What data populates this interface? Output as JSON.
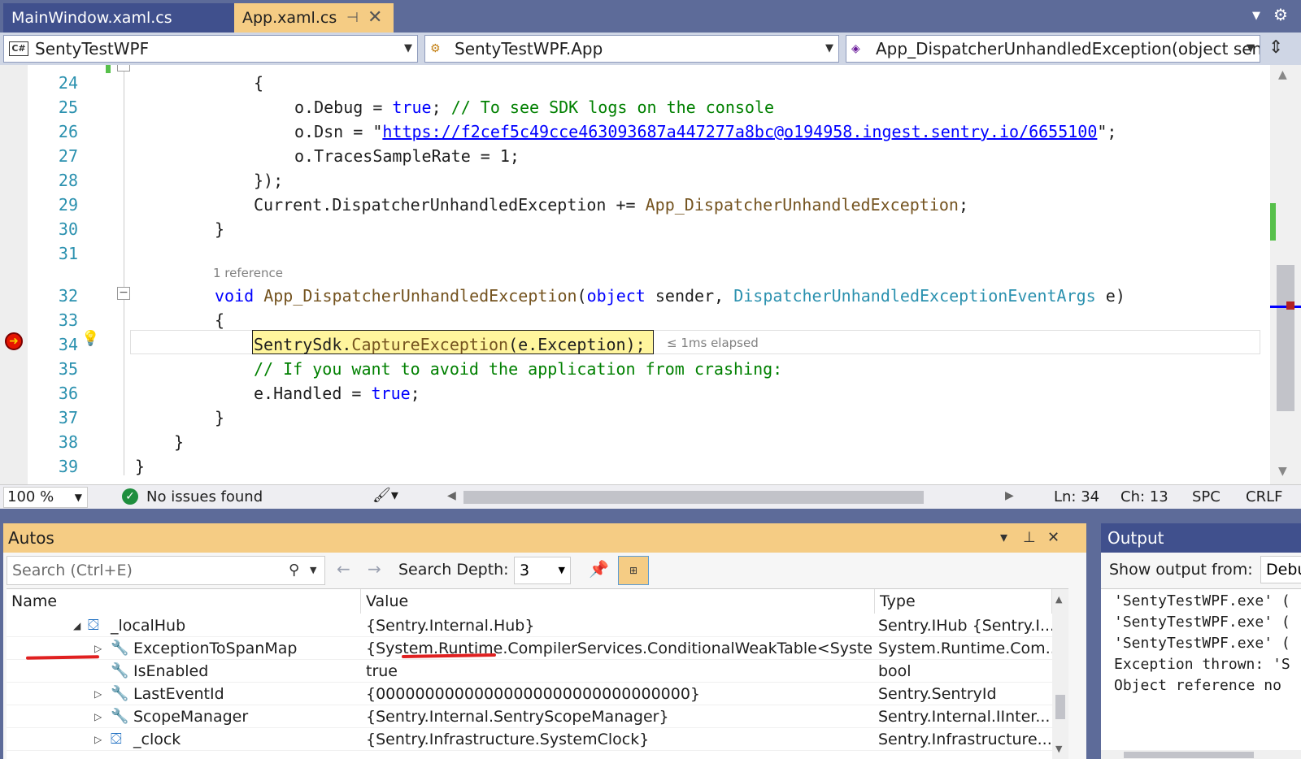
{
  "tabs": {
    "main": "MainWindow.xaml.cs",
    "app": "App.xaml.cs"
  },
  "navbar": {
    "project": "SentyTestWPF",
    "class": "SentyTestWPF.App",
    "member": "App_DispatcherUnhandledException(object send"
  },
  "editor": {
    "line_numbers": [
      "24",
      "25",
      "26",
      "27",
      "28",
      "29",
      "30",
      "31",
      "32",
      "33",
      "34",
      "35",
      "36",
      "37",
      "38",
      "39"
    ],
    "codelens": "1 reference",
    "elapsed": "≤ 1ms elapsed",
    "current_line": 34
  },
  "code": {
    "l24": "{",
    "l25_a": "o.Debug = ",
    "l25_kw": "true",
    "l25_b": "; ",
    "l25_cm": "// To see SDK logs on the console",
    "l26_a": "o.Dsn = \"",
    "l26_url": "https://f2cef5c49cce463093687a447277a8bc@o194958.ingest.sentry.io/6655100",
    "l26_b": "\";",
    "l27": "o.TracesSampleRate = 1;",
    "l28": "});",
    "l29_a": "Current.DispatcherUnhandledException += ",
    "l29_mt": "App_DispatcherUnhandledException",
    "l29_b": ";",
    "l30": "}",
    "l32_kw": "void",
    "l32_mt": "App_DispatcherUnhandledException",
    "l32_a": "(",
    "l32_kw2": "object",
    "l32_b": " sender, ",
    "l32_ty": "DispatcherUnhandledExceptionEventArgs",
    "l32_c": " e)",
    "l33": "{",
    "l34_a": "SentrySdk",
    "l34_b": ".",
    "l34_mt": "CaptureException",
    "l34_c": "(e.Exception);",
    "l35": "// If you want to avoid the application from crashing:",
    "l36_a": "e.Handled = ",
    "l36_kw": "true",
    "l36_b": ";",
    "l37": "}",
    "l38": "}",
    "l39": "}"
  },
  "status": {
    "zoom": "100 %",
    "issues": "No issues found",
    "ln": "Ln: 34",
    "ch": "Ch: 13",
    "spc": "SPC",
    "crlf": "CRLF"
  },
  "autos": {
    "title": "Autos",
    "search_placeholder": "Search (Ctrl+E)",
    "depth_label": "Search Depth:",
    "depth_value": "3",
    "columns": [
      "Name",
      "Value",
      "Type"
    ],
    "rows": [
      {
        "name": "_localHub",
        "value": "{Sentry.Internal.Hub}",
        "type": "Sentry.IHub {Sentry.I..."
      },
      {
        "name": "ExceptionToSpanMap",
        "value": "{System.Runtime.CompilerServices.ConditionalWeakTable<System.E...",
        "type": "System.Runtime.Com..."
      },
      {
        "name": "IsEnabled",
        "value": "true",
        "type": "bool"
      },
      {
        "name": "LastEventId",
        "value": "{00000000000000000000000000000000}",
        "type": "Sentry.SentryId"
      },
      {
        "name": "ScopeManager",
        "value": "{Sentry.Internal.SentryScopeManager}",
        "type": "Sentry.Internal.IInter..."
      },
      {
        "name": "_clock",
        "value": "{Sentry.Infrastructure.SystemClock}",
        "type": "Sentry.Infrastructure...."
      }
    ]
  },
  "output": {
    "title": "Output",
    "show_from": "Show output from:",
    "source": "Debu",
    "lines": [
      "'SentyTestWPF.exe' (",
      "'SentyTestWPF.exe' (",
      "'SentyTestWPF.exe' (",
      "Exception thrown: 'S",
      "Object reference no"
    ]
  },
  "colors": {
    "accent_tab": "#f5cc84",
    "chrome": "#5d6b99",
    "annotation": "#e02020"
  }
}
